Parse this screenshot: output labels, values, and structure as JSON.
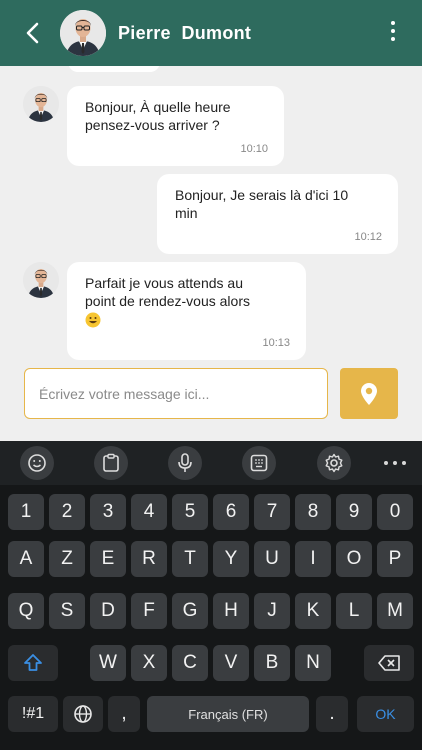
{
  "header": {
    "contact_name": "Pierre  Dumont",
    "bg_color": "#2e6b5e",
    "icons": {
      "back": "arrow-left-icon",
      "menu": "more-vertical-icon"
    }
  },
  "messages": [
    {
      "id": "m1",
      "side": "incoming",
      "text": "Bonjour, À quelle heure\npensez-vous arriver ?",
      "time": "10:10"
    },
    {
      "id": "m2",
      "side": "outgoing",
      "text": "Bonjour, Je serais là d'ici 10\nmin",
      "time": "10:12"
    },
    {
      "id": "m3",
      "side": "incoming",
      "text": "Parfait je vous attends au\npoint de rendez-vous alors",
      "emoji": "grinning-face",
      "time": "10:13"
    }
  ],
  "composer": {
    "placeholder": "Écrivez votre message ici...",
    "accent_color": "#e6b64a",
    "send_location_icon": "location-pin-icon"
  },
  "keyboard": {
    "toolbar_icons": [
      "emoji-icon",
      "clipboard-icon",
      "microphone-icon",
      "keyboard-icon",
      "gear-icon",
      "more-horizontal-icon"
    ],
    "row_numbers": [
      "1",
      "2",
      "3",
      "4",
      "5",
      "6",
      "7",
      "8",
      "9",
      "0"
    ],
    "row1": [
      "A",
      "Z",
      "E",
      "R",
      "T",
      "Y",
      "U",
      "I",
      "O",
      "P"
    ],
    "row2": [
      "Q",
      "S",
      "D",
      "F",
      "G",
      "H",
      "J",
      "K",
      "L",
      "M"
    ],
    "row3": [
      "W",
      "X",
      "C",
      "V",
      "B",
      "N"
    ],
    "symbols_label": "!#1",
    "comma_label": ",",
    "space_label": "Français (FR)",
    "period_label": ".",
    "enter_label": "OK"
  }
}
